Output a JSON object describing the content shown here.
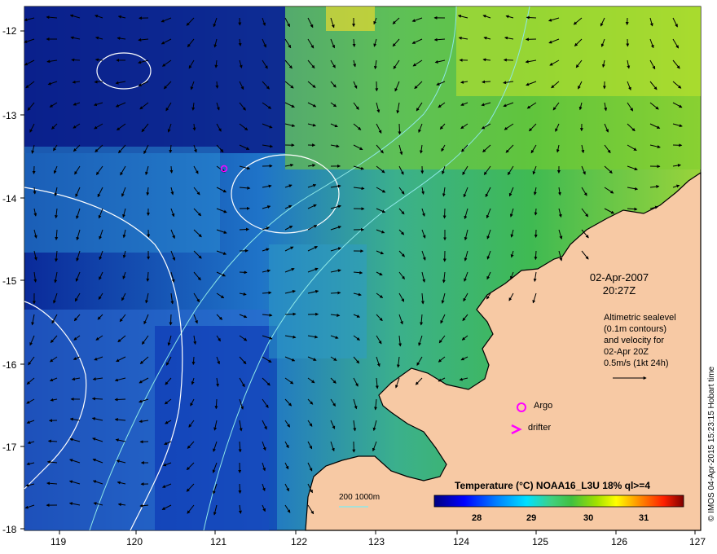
{
  "date_line1": "02-Apr-2007",
  "date_line2": "20:27Z",
  "info_lines": [
    "Altimetric sealevel",
    "(0.1m contours)",
    "and velocity for",
    "02-Apr 20Z",
    "0.5m/s (1kt 24h)"
  ],
  "argo_label": "Argo",
  "drifter_label": "drifter",
  "depth_label": "200  1000m",
  "colorbar_title": "Temperature (°C) NOAA16_L3U 18% ql>=4",
  "colorbar_ticks": [
    "28",
    "29",
    "30",
    "31"
  ],
  "credit": "© IMOS 04-Apr-2015 15:23:15 Hobart time",
  "x_ticks": [
    "119",
    "120",
    "121",
    "122",
    "123",
    "124",
    "125",
    "126",
    "127"
  ],
  "y_ticks": [
    "-12",
    "-13",
    "-14",
    "-15",
    "-16",
    "-17",
    "-18"
  ],
  "colors": {
    "land": "#f7c9a4",
    "coast": "#000000",
    "contour_sealevel": "#ffffff",
    "contour_depth": "#8ee8e8",
    "argo_marker": "#ff00ff",
    "drifter_marker": "#ff00ff",
    "colormap": [
      "#00007f",
      "#0000ff",
      "#0080ff",
      "#00e0ff",
      "#40d080",
      "#40c040",
      "#a0e000",
      "#ffff00",
      "#ff9000",
      "#ff2000",
      "#800000"
    ]
  }
}
